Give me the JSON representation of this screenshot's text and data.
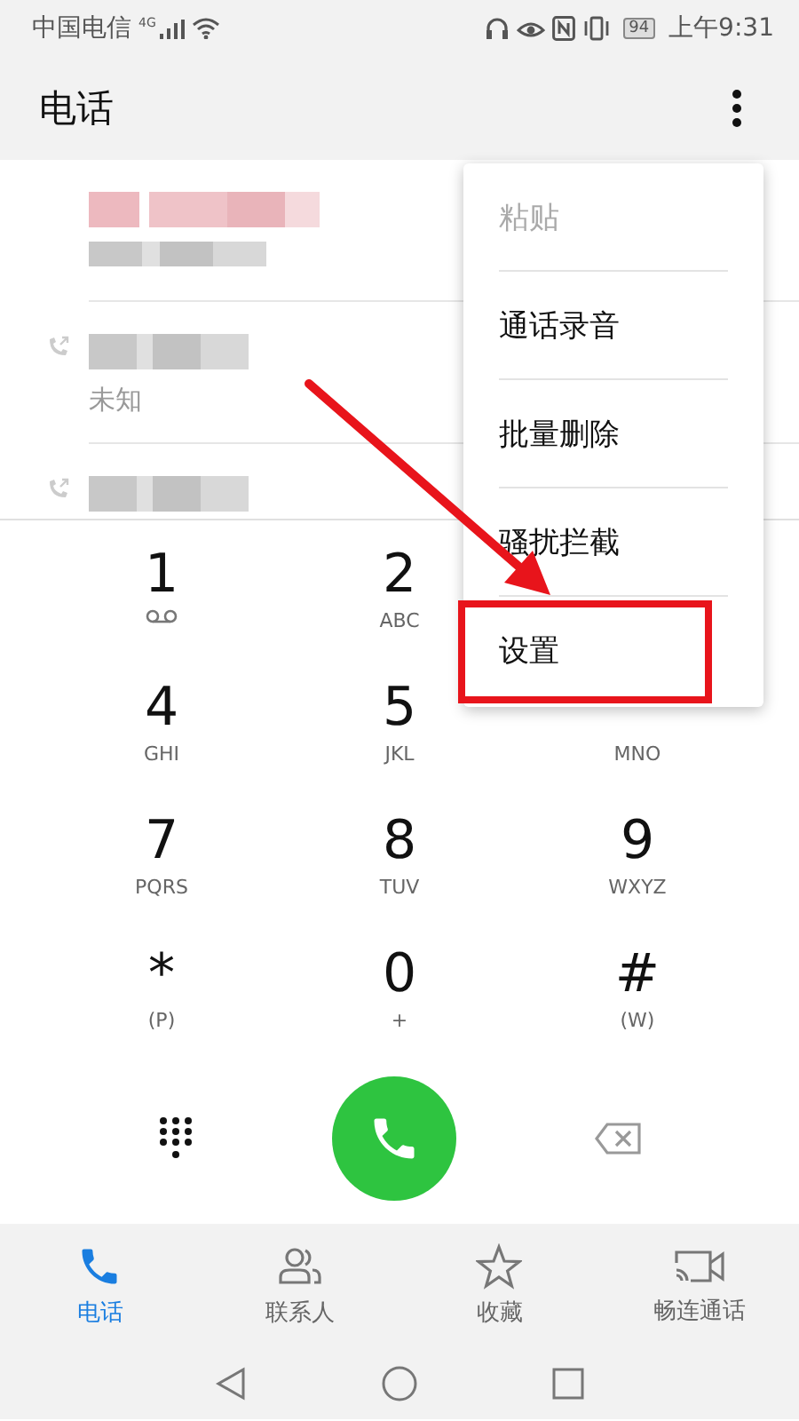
{
  "status_bar": {
    "carrier": "中国电信",
    "network": "4G",
    "battery": "94",
    "time": "上午9:31"
  },
  "app_bar": {
    "title": "电话"
  },
  "call_log": [
    {
      "kind": "contact"
    },
    {
      "kind": "unknown",
      "note": "未知"
    },
    {
      "kind": "number"
    }
  ],
  "menu": [
    {
      "label": "粘贴",
      "disabled": true,
      "highlighted": false
    },
    {
      "label": "通话录音",
      "disabled": false,
      "highlighted": false
    },
    {
      "label": "批量删除",
      "disabled": false,
      "highlighted": false
    },
    {
      "label": "骚扰拦截",
      "disabled": false,
      "highlighted": false
    },
    {
      "label": "设置",
      "disabled": false,
      "highlighted": true
    }
  ],
  "keys": [
    {
      "digit": "1",
      "kind": "voicemail"
    },
    {
      "digit": "2",
      "sub": "ABC",
      "kind": "digit"
    },
    {
      "kind": "hidden"
    },
    {
      "digit": "4",
      "sub": "GHI",
      "kind": "digit"
    },
    {
      "digit": "5",
      "sub": "JKL",
      "kind": "digit"
    },
    {
      "sub": "MNO",
      "kind": "covered"
    },
    {
      "digit": "7",
      "sub": "PQRS",
      "kind": "digit"
    },
    {
      "digit": "8",
      "sub": "TUV",
      "kind": "digit"
    },
    {
      "digit": "9",
      "sub": "WXYZ",
      "kind": "digit"
    },
    {
      "digit": "*",
      "sub": "(P)",
      "kind": "digit"
    },
    {
      "digit": "0",
      "sub": "+",
      "kind": "digit"
    },
    {
      "digit": "#",
      "sub": "(W)",
      "kind": "digit"
    }
  ],
  "tabs": [
    {
      "label": "电话",
      "selected": true,
      "kind": "phone"
    },
    {
      "label": "联系人",
      "selected": false,
      "kind": "contacts"
    },
    {
      "label": "收藏",
      "selected": false,
      "kind": "star"
    },
    {
      "label": "畅连通话",
      "selected": false,
      "kind": "video"
    }
  ]
}
